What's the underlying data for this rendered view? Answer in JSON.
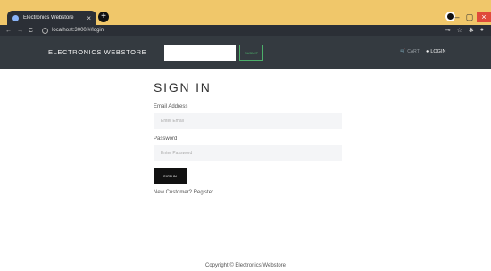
{
  "browser": {
    "tab_title": "Electronics Webstore",
    "tab_close": "×",
    "new_tab": "+",
    "url": "localhost:3000/#/login",
    "nav_back": "←",
    "nav_forward": "→",
    "nav_reload": "C",
    "toolbar_icons": [
      "⊸",
      "☆",
      "✱",
      "●"
    ],
    "window_min": "–",
    "window_max": "▢",
    "window_close": "×"
  },
  "header": {
    "brand": "ELECTRONICS WEBSTORE",
    "search_placeholder": "",
    "submit_label": "SUBMIT",
    "cart_label": "CART",
    "login_label": "LOGIN"
  },
  "form": {
    "title": "SIGN IN",
    "email_label": "Email Address",
    "email_placeholder": "Enter Email",
    "password_label": "Password",
    "password_placeholder": "Enter Password",
    "signin_label": "SIGN IN",
    "new_customer_text": "New Customer?",
    "register_label": "Register"
  },
  "footer": {
    "copyright": "Copyright © Electronics Webstore"
  },
  "colors": {
    "tab_strip": "#f0c76a",
    "navbar": "#343a40",
    "submit_border": "#4caf6a"
  }
}
